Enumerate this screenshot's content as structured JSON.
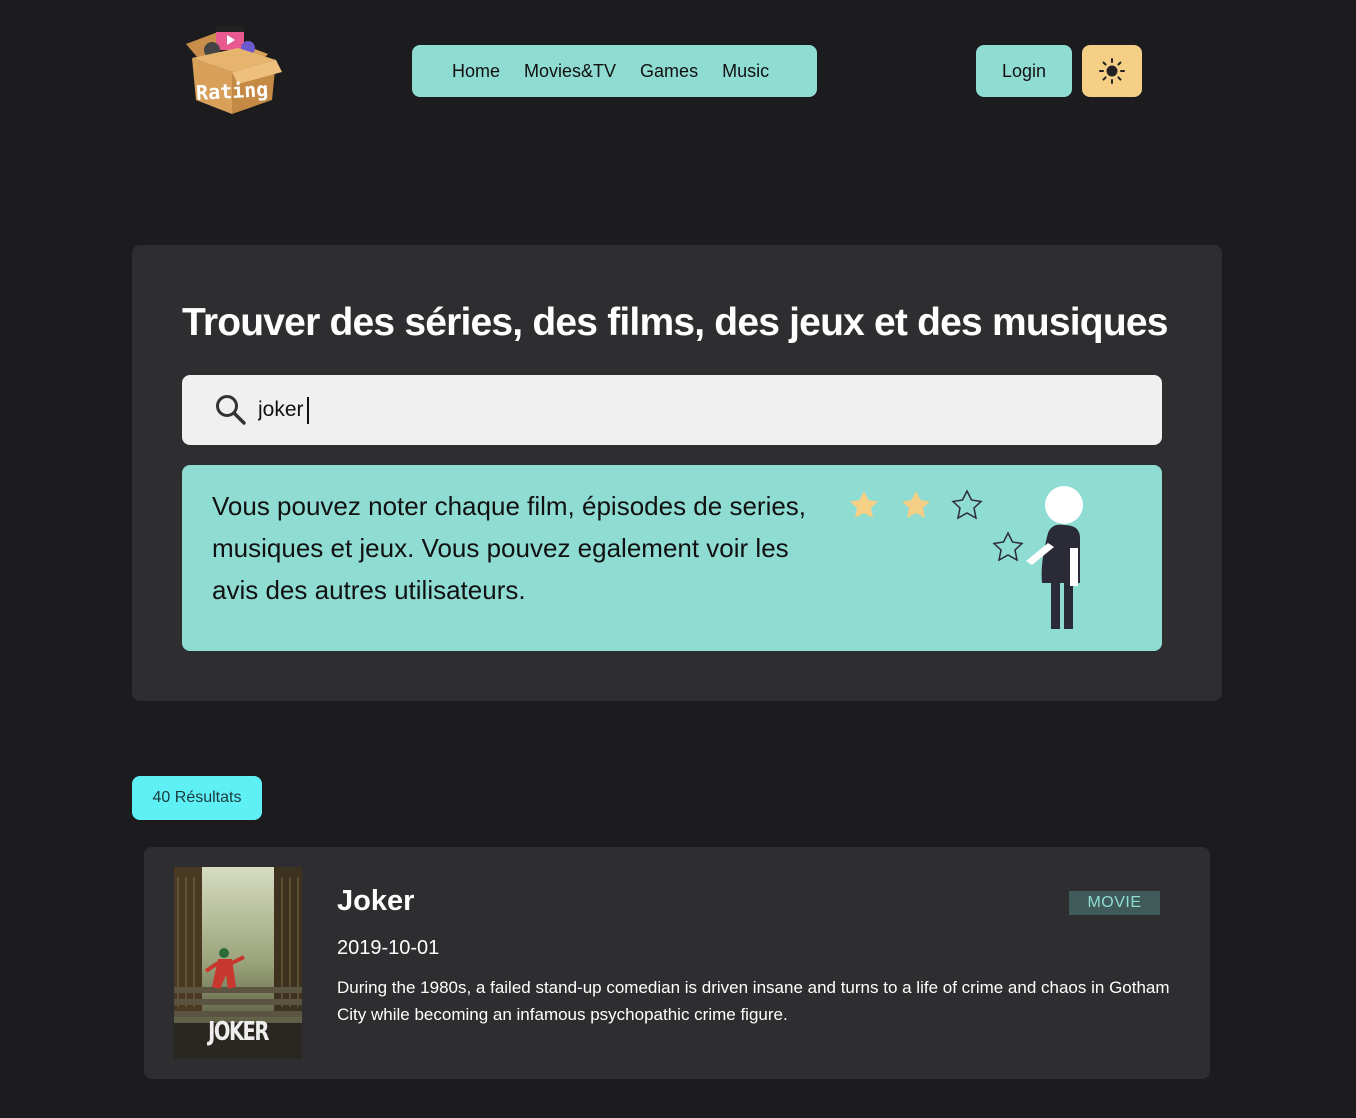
{
  "header": {
    "logo_text": "Rating",
    "nav": [
      "Home",
      "Movies&TV",
      "Games",
      "Music"
    ],
    "login_label": "Login",
    "theme_icon": "sun-icon"
  },
  "hero": {
    "title": "Trouver des séries, des films, des jeux et des musiques",
    "search": {
      "value": "joker",
      "icon": "search-icon"
    },
    "info_text": "Vous pouvez noter chaque film, épisodes de series, musiques et jeux. Vous pouvez egalement voir les avis des autres utilisateurs."
  },
  "results": {
    "count_label": "40 Résultats",
    "items": [
      {
        "title": "Joker",
        "date": "2019-10-01",
        "type": "MOVIE",
        "description": "During the 1980s, a failed stand-up comedian is driven insane and turns to a life of crime and chaos in Gotham City while becoming an infamous psychopathic crime figure.",
        "poster_text": "JOKER"
      }
    ]
  },
  "colors": {
    "background": "#1c1c1f",
    "panel": "#2e2e31",
    "accent": "#8fdcd3",
    "theme_button": "#f6cf86",
    "results_badge": "#5ff0f5"
  }
}
